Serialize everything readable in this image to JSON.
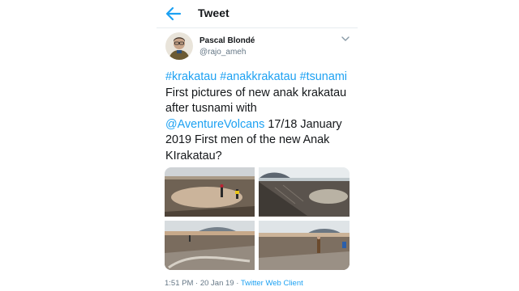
{
  "header": {
    "title": "Tweet",
    "back_icon": "arrow-left-icon"
  },
  "author": {
    "name": "Pascal Blondé",
    "handle": "@rajo_ameh"
  },
  "tweet": {
    "hashtags": [
      "#krakatau",
      "#anakkrakatau",
      "#tsunami"
    ],
    "text_1": "First pictures of new anak krakatau after tusnami with",
    "mention": "@AventureVolcans",
    "text_2": "17/18 January 2019 First men of the new Anak KIrakatau?"
  },
  "media": {
    "photo_count": 4
  },
  "meta": {
    "time": "1:51 PM",
    "sep": "·",
    "date": "20 Jan 19",
    "client": "Twitter Web Client"
  },
  "colors": {
    "link": "#1da1f2",
    "muted": "#657786",
    "divider": "#e6ecf0"
  }
}
